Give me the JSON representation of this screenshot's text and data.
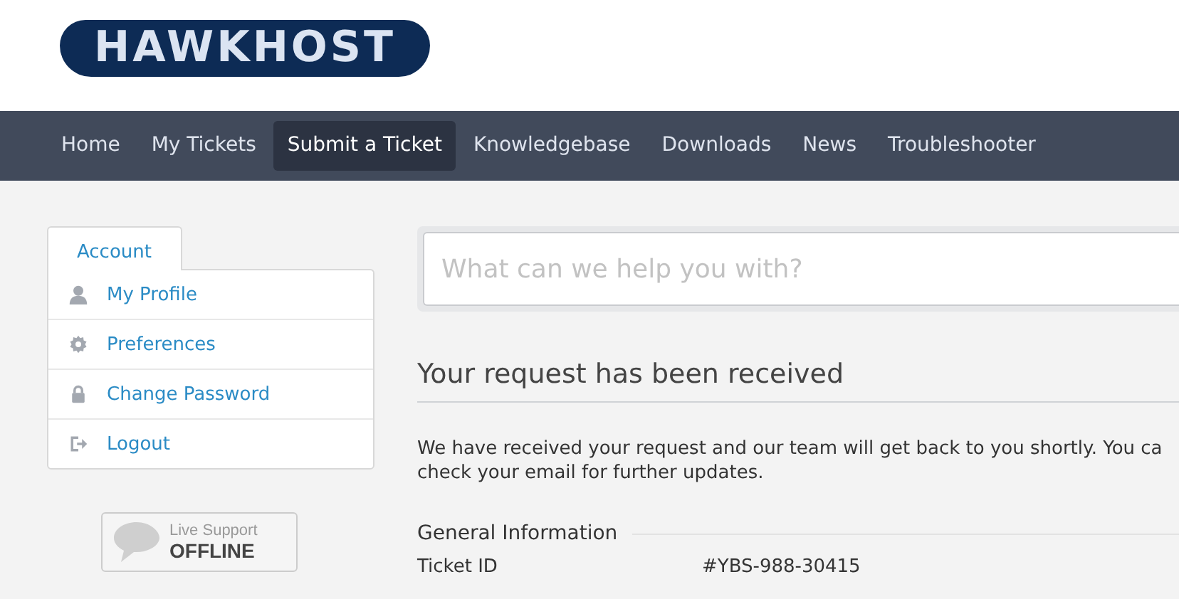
{
  "logo": {
    "text": "HAWKHOST"
  },
  "nav": [
    {
      "label": "Home",
      "selected": false
    },
    {
      "label": "My Tickets",
      "selected": false
    },
    {
      "label": "Submit a Ticket",
      "selected": true
    },
    {
      "label": "Knowledgebase",
      "selected": false
    },
    {
      "label": "Downloads",
      "selected": false
    },
    {
      "label": "News",
      "selected": false
    },
    {
      "label": "Troubleshooter",
      "selected": false
    }
  ],
  "sidebar": {
    "tab": "Account",
    "items": [
      {
        "label": "My Profile",
        "kind": "user"
      },
      {
        "label": "Preferences",
        "kind": "gear"
      },
      {
        "label": "Change Password",
        "kind": "lock"
      },
      {
        "label": "Logout",
        "kind": "logout"
      }
    ]
  },
  "live_support": {
    "label": "Live Support",
    "status": "OFFLINE"
  },
  "search": {
    "placeholder": "What can we help you with?"
  },
  "heading": "Your request has been received",
  "message_lines": [
    "We have received your request and our team will get back to you shortly. You ca",
    "check your email for further updates."
  ],
  "section": "General Information",
  "fields": [
    {
      "label": "Ticket ID",
      "value": "#YBS-988-30415"
    }
  ]
}
